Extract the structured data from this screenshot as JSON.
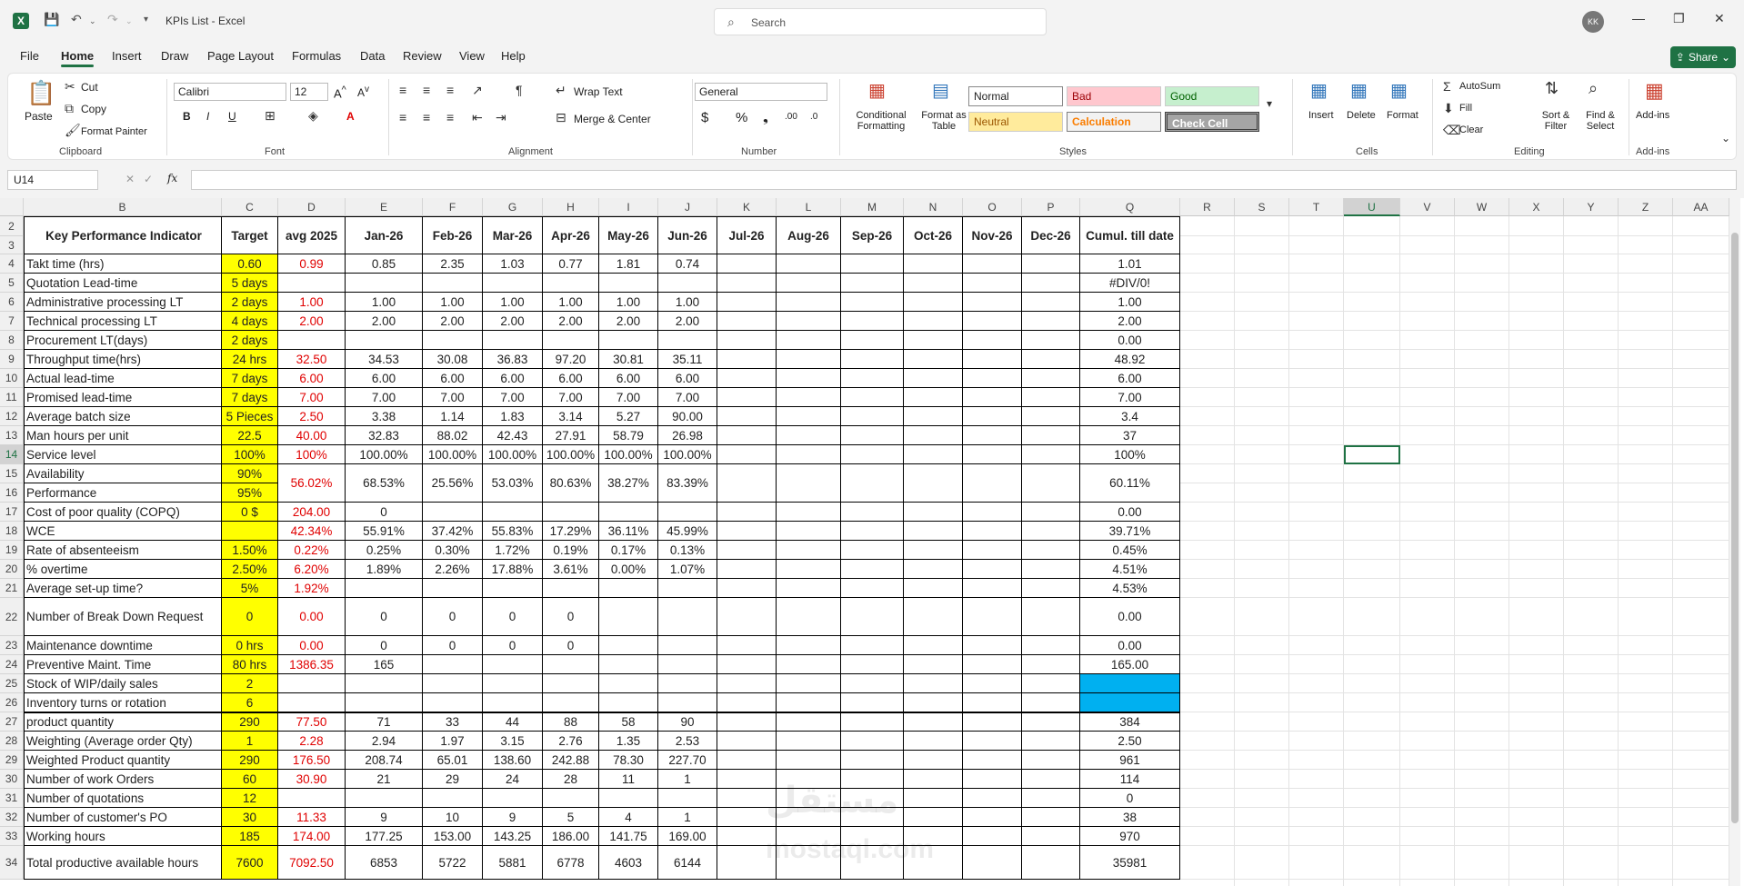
{
  "window": {
    "title": "KPIs List  -  Excel",
    "search_placeholder": "Search",
    "user_initials": "KK"
  },
  "menu": [
    "File",
    "Home",
    "Insert",
    "Draw",
    "Page Layout",
    "Formulas",
    "Data",
    "Review",
    "View",
    "Help"
  ],
  "share_label": "Share",
  "ribbon": {
    "clipboard": {
      "paste": "Paste",
      "cut": "Cut",
      "copy": "Copy",
      "format_painter": "Format Painter",
      "label": "Clipboard"
    },
    "font": {
      "name": "Calibri",
      "size": "12",
      "label": "Font"
    },
    "alignment": {
      "wrap_text": "Wrap Text",
      "merge_center": "Merge & Center",
      "label": "Alignment"
    },
    "number": {
      "format": "General",
      "label": "Number"
    },
    "styles": {
      "conditional": "Conditional Formatting",
      "format_table": "Format as Table",
      "normal": "Normal",
      "bad": "Bad",
      "good": "Good",
      "neutral": "Neutral",
      "calculation": "Calculation",
      "check_cell": "Check Cell",
      "label": "Styles"
    },
    "cells": {
      "insert": "Insert",
      "delete": "Delete",
      "format": "Format",
      "label": "Cells"
    },
    "editing": {
      "autosum": "AutoSum",
      "fill": "Fill",
      "clear": "Clear",
      "sort_filter": "Sort & Filter",
      "find_select": "Find & Select",
      "label": "Editing"
    },
    "addins": {
      "addins": "Add-ins",
      "label": "Add-ins"
    }
  },
  "name_box": "U14",
  "fx_label": "fx",
  "columns": [
    "B",
    "C",
    "D",
    "E",
    "F",
    "G",
    "H",
    "I",
    "J",
    "K",
    "L",
    "M",
    "N",
    "O",
    "P",
    "Q",
    "R",
    "S",
    "T",
    "U",
    "V",
    "W",
    "X",
    "Y",
    "Z",
    "AA"
  ],
  "header": {
    "kpi": "Key Performance Indicator",
    "target": "Target",
    "avg": "avg 2025",
    "months": [
      "Jan-26",
      "Feb-26",
      "Mar-26",
      "Apr-26",
      "May-26",
      "Jun-26",
      "Jul-26",
      "Aug-26",
      "Sep-26",
      "Oct-26",
      "Nov-26",
      "Dec-26"
    ],
    "cumul": "Cumul. till date"
  },
  "rows": [
    {
      "r": "4",
      "kpi": "Takt time (hrs)",
      "target": "0.60",
      "avg": "0.99",
      "m": [
        "0.85",
        "2.35",
        "1.03",
        "0.77",
        "1.81",
        "0.74"
      ],
      "q": "1.01"
    },
    {
      "r": "5",
      "kpi": "Quotation Lead-time",
      "target": "5 days",
      "avg": "",
      "m": [
        "",
        "",
        "",
        "",
        "",
        ""
      ],
      "q": "#DIV/0!"
    },
    {
      "r": "6",
      "kpi": "Administrative processing LT",
      "target": "2 days",
      "avg": "1.00",
      "m": [
        "1.00",
        "1.00",
        "1.00",
        "1.00",
        "1.00",
        "1.00"
      ],
      "q": "1.00"
    },
    {
      "r": "7",
      "kpi": "Technical processing  LT",
      "target": "4 days",
      "avg": "2.00",
      "m": [
        "2.00",
        "2.00",
        "2.00",
        "2.00",
        "2.00",
        "2.00"
      ],
      "q": "2.00"
    },
    {
      "r": "8",
      "kpi": "Procurement LT(days)",
      "target": "2 days",
      "avg": "",
      "m": [
        "",
        "",
        "",
        "",
        "",
        ""
      ],
      "q": "0.00"
    },
    {
      "r": "9",
      "kpi": "Throughput time(hrs)",
      "target": "24 hrs",
      "avg": "32.50",
      "m": [
        "34.53",
        "30.08",
        "36.83",
        "97.20",
        "30.81",
        "35.11"
      ],
      "q": "48.92"
    },
    {
      "r": "10",
      "kpi": "Actual lead-time",
      "target": "7 days",
      "avg": "6.00",
      "m": [
        "6.00",
        "6.00",
        "6.00",
        "6.00",
        "6.00",
        "6.00"
      ],
      "q": "6.00"
    },
    {
      "r": "11",
      "kpi": "Promised lead-time",
      "target": "7 days",
      "avg": "7.00",
      "m": [
        "7.00",
        "7.00",
        "7.00",
        "7.00",
        "7.00",
        "7.00"
      ],
      "q": "7.00"
    },
    {
      "r": "12",
      "kpi": "Average batch size",
      "target": "5 Pieces",
      "avg": "2.50",
      "m": [
        "3.38",
        "1.14",
        "1.83",
        "3.14",
        "5.27",
        "90.00"
      ],
      "q": "3.4"
    },
    {
      "r": "13",
      "kpi": "Man hours per unit",
      "target": "22.5",
      "avg": "40.00",
      "m": [
        "32.83",
        "88.02",
        "42.43",
        "27.91",
        "58.79",
        "26.98"
      ],
      "q": "37"
    },
    {
      "r": "14",
      "kpi": "Service level",
      "target": "100%",
      "avg": "100%",
      "m": [
        "100.00%",
        "100.00%",
        "100.00%",
        "100.00%",
        "100.00%",
        "100.00%"
      ],
      "q": "100%"
    }
  ],
  "row15_16": {
    "kpi15": "Availability",
    "kpi16": "Performance",
    "target15": "90%",
    "target16": "95%",
    "avg": "56.02%",
    "m": [
      "68.53%",
      "25.56%",
      "53.03%",
      "80.63%",
      "38.27%",
      "83.39%"
    ],
    "q": "60.11%"
  },
  "rows2": [
    {
      "r": "17",
      "kpi": "Cost of poor quality (COPQ)",
      "target": "0 $",
      "avg": "204.00",
      "m": [
        "0",
        "",
        "",
        "",
        "",
        ""
      ],
      "q": "0.00"
    },
    {
      "r": "18",
      "kpi": "WCE",
      "target": "",
      "avg": "42.34%",
      "m": [
        "55.91%",
        "37.42%",
        "55.83%",
        "17.29%",
        "36.11%",
        "45.99%"
      ],
      "q": "39.71%"
    },
    {
      "r": "19",
      "kpi": "Rate of absenteeism",
      "target": "1.50%",
      "avg": "0.22%",
      "m": [
        "0.25%",
        "0.30%",
        "1.72%",
        "0.19%",
        "0.17%",
        "0.13%"
      ],
      "q": "0.45%"
    },
    {
      "r": "20",
      "kpi": "% overtime",
      "target": "2.50%",
      "avg": "6.20%",
      "m": [
        "1.89%",
        "2.26%",
        "17.88%",
        "3.61%",
        "0.00%",
        "1.07%"
      ],
      "q": "4.51%"
    },
    {
      "r": "21",
      "kpi": "Average set-up time?",
      "target": "5%",
      "avg": "1.92%",
      "m": [
        "",
        "",
        "",
        "",
        "",
        ""
      ],
      "q": "4.53%"
    }
  ],
  "row22": {
    "r": "22",
    "kpi": "Number of Break Down Request",
    "target": "0",
    "avg": "0.00",
    "m": [
      "0",
      "0",
      "0",
      "0",
      "",
      ""
    ],
    "q": "0.00"
  },
  "rows3": [
    {
      "r": "23",
      "kpi": "Maintenance downtime",
      "target": "0 hrs",
      "avg": "0.00",
      "m": [
        "0",
        "0",
        "0",
        "0",
        "",
        ""
      ],
      "q": "0.00"
    },
    {
      "r": "24",
      "kpi": "Preventive Maint. Time",
      "target": "80 hrs",
      "avg": "1386.35",
      "m": [
        "165",
        "",
        "",
        "",
        "",
        ""
      ],
      "q": "165.00"
    },
    {
      "r": "25",
      "kpi": "Stock of WIP/daily sales",
      "target": "2",
      "avg": "",
      "m": [
        "",
        "",
        "",
        "",
        "",
        ""
      ],
      "q": ""
    },
    {
      "r": "26",
      "kpi": "Inventory turns or rotation",
      "target": "6",
      "avg": "",
      "m": [
        "",
        "",
        "",
        "",
        "",
        ""
      ],
      "q": ""
    },
    {
      "r": "27",
      "kpi": "product quantity",
      "target": "290",
      "avg": "77.50",
      "m": [
        "71",
        "33",
        "44",
        "88",
        "58",
        "90"
      ],
      "q": "384"
    },
    {
      "r": "28",
      "kpi": "Weighting (Average order Qty)",
      "target": "1",
      "avg": "2.28",
      "m": [
        "2.94",
        "1.97",
        "3.15",
        "2.76",
        "1.35",
        "2.53"
      ],
      "q": "2.50"
    },
    {
      "r": "29",
      "kpi": "Weighted Product quantity",
      "target": "290",
      "avg": "176.50",
      "m": [
        "208.74",
        "65.01",
        "138.60",
        "242.88",
        "78.30",
        "227.70"
      ],
      "q": "961"
    },
    {
      "r": "30",
      "kpi": "Number of work Orders",
      "target": "60",
      "avg": "30.90",
      "m": [
        "21",
        "29",
        "24",
        "28",
        "11",
        "1"
      ],
      "q": "114"
    },
    {
      "r": "31",
      "kpi": "Number of quotations",
      "target": "12",
      "avg": "",
      "m": [
        "",
        "",
        "",
        "",
        "",
        ""
      ],
      "q": "0"
    },
    {
      "r": "32",
      "kpi": "Number of customer's PO",
      "target": "30",
      "avg": "11.33",
      "m": [
        "9",
        "10",
        "9",
        "5",
        "4",
        "1"
      ],
      "q": "38"
    },
    {
      "r": "33",
      "kpi": "Working hours",
      "target": "185",
      "avg": "174.00",
      "m": [
        "177.25",
        "153.00",
        "143.25",
        "186.00",
        "141.75",
        "169.00"
      ],
      "q": "970"
    }
  ],
  "row34": {
    "r": "34",
    "kpi": "Total productive available hours",
    "target": "7600",
    "avg": "7092.50",
    "m": [
      "6853",
      "5722",
      "5881",
      "6778",
      "4603",
      "6144"
    ],
    "q": "35981"
  },
  "watermark": {
    "line1": "مستقل",
    "line2": "mostaql.com"
  }
}
